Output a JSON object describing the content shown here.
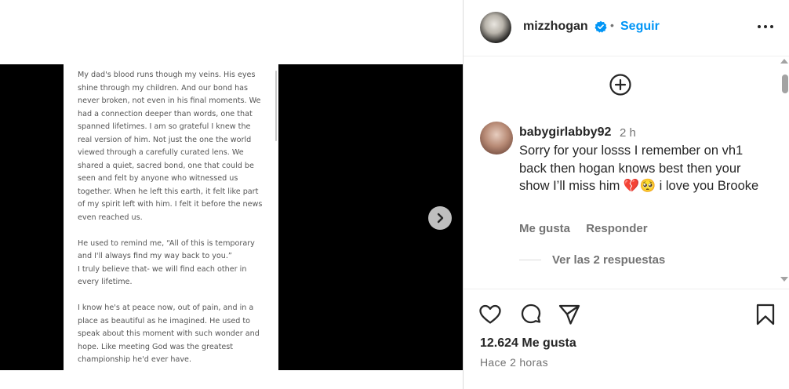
{
  "post": {
    "document_paragraphs": [
      "My dad's blood runs though my veins. His eyes shine through my children. And our bond has never broken, not even in his final moments. We had a connection deeper than words, one that spanned lifetimes. I am so grateful I knew the real version of him. Not just the one the world viewed through a carefully curated lens. We shared a quiet, sacred bond, one that could be seen and felt by anyone who witnessed us together. When he left this earth, it felt like part of my spirit left with him. I felt it before the news even reached us.",
      "He used to remind me, “All of this is temporary and I'll always find my way back to you.”",
      "I truly believe that- we will find each other in every lifetime.",
      "I know he's at peace now, out of pain, and in a place as beautiful as he imagined. He used to speak about this moment with such wonder and hope.  Like meeting God was the greatest championship he'd ever have."
    ]
  },
  "header": {
    "username": "mizzhogan",
    "separator": "•",
    "follow_label": "Seguir"
  },
  "comment": {
    "username": "babygirlabby92",
    "time": "2 h",
    "text": "Sorry for your losss I remember on vh1 back then hogan knows best then your show I’ll miss him 💔🥺  i love you Brooke",
    "like_label": "Me gusta",
    "reply_label": "Responder",
    "view_replies": "Ver las 2 respuestas"
  },
  "footer": {
    "likes": "12.624 Me gusta",
    "time_ago": "Hace 2 horas"
  },
  "colors": {
    "accent": "#0095f6",
    "text_primary": "#262626",
    "text_secondary": "#737373"
  },
  "icons": {
    "verified": "verified-badge-icon",
    "more": "more-options-icon",
    "add_comment": "add-circle-icon",
    "next": "chevron-right-icon",
    "like": "heart-icon",
    "comment": "comment-icon",
    "share": "send-icon",
    "save": "bookmark-icon"
  }
}
